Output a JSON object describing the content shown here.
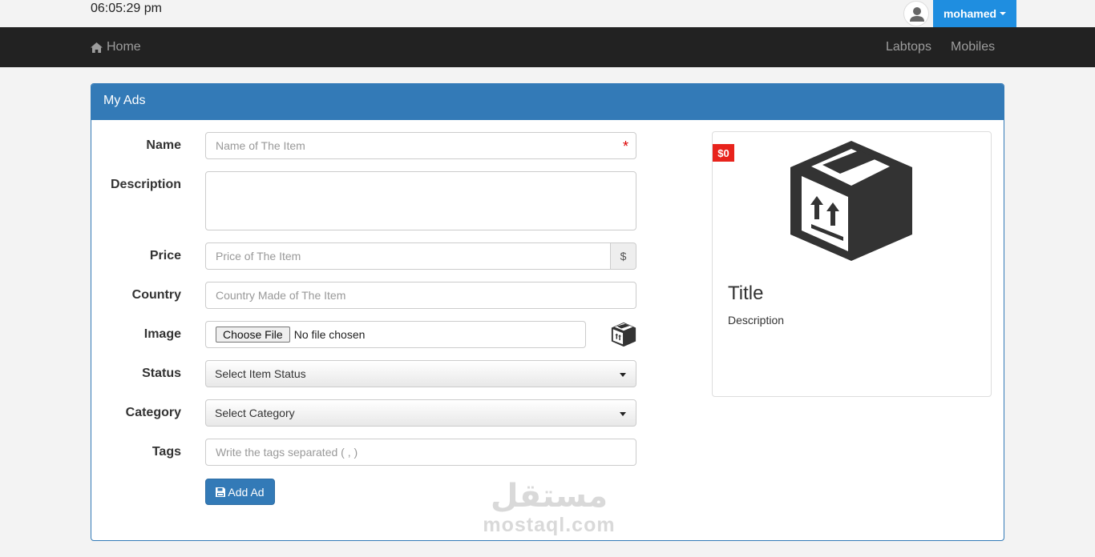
{
  "header": {
    "time": "06:05:29 pm",
    "user_name": "mohamed",
    "avatar_icon": "user-icon"
  },
  "navbar": {
    "home_label": "Home",
    "home_icon": "home-icon",
    "links": [
      "Labtops",
      "Mobiles"
    ]
  },
  "panel": {
    "title": "My Ads"
  },
  "form": {
    "name": {
      "label": "Name",
      "placeholder": "Name of The Item",
      "required_mark": "*"
    },
    "description": {
      "label": "Description",
      "value": ""
    },
    "price": {
      "label": "Price",
      "placeholder": "Price of The Item",
      "addon": "$"
    },
    "country": {
      "label": "Country",
      "placeholder": "Country Made of The Item"
    },
    "image": {
      "label": "Image",
      "button": "Choose File",
      "status": "No file chosen",
      "preview_icon": "box-icon"
    },
    "status": {
      "label": "Status",
      "selected": "Select Item Status"
    },
    "category": {
      "label": "Category",
      "selected": "Select Category"
    },
    "tags": {
      "label": "Tags",
      "placeholder": "Write the tags separated ( , )"
    },
    "submit": {
      "label": "Add Ad",
      "icon": "save-icon"
    }
  },
  "preview": {
    "price": "$0",
    "title": "Title",
    "description": "Description",
    "image_icon": "box-icon"
  },
  "watermark": {
    "arabic": "مستقل",
    "latin": "mostaql.com"
  },
  "colors": {
    "primary": "#337ab7",
    "navbar": "#222222",
    "user_button": "#1f8ee0",
    "price_tag": "#e8231c"
  }
}
